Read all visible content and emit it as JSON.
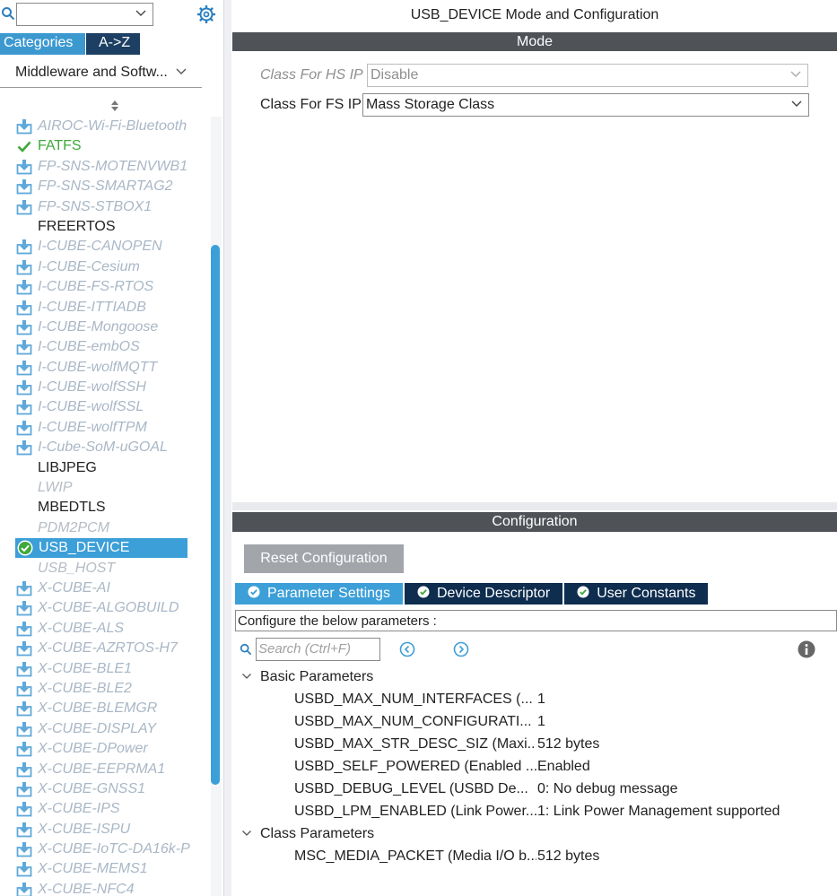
{
  "left_panel": {
    "search_value": "",
    "tabs": {
      "categories": "Categories",
      "az": "A->Z"
    },
    "category_select": "Middleware and Softw...",
    "items": [
      {
        "label": "AIROC-Wi-Fi-Bluetooth",
        "state": "avail"
      },
      {
        "label": "FATFS",
        "state": "ok"
      },
      {
        "label": "FP-SNS-MOTENVWB1",
        "state": "avail"
      },
      {
        "label": "FP-SNS-SMARTAG2",
        "state": "avail"
      },
      {
        "label": "FP-SNS-STBOX1",
        "state": "avail"
      },
      {
        "label": "FREERTOS",
        "state": "plain"
      },
      {
        "label": "I-CUBE-CANOPEN",
        "state": "avail"
      },
      {
        "label": "I-CUBE-Cesium",
        "state": "avail"
      },
      {
        "label": "I-CUBE-FS-RTOS",
        "state": "avail"
      },
      {
        "label": "I-CUBE-ITTIADB",
        "state": "avail"
      },
      {
        "label": "I-CUBE-Mongoose",
        "state": "avail"
      },
      {
        "label": "I-CUBE-embOS",
        "state": "avail"
      },
      {
        "label": "I-CUBE-wolfMQTT",
        "state": "avail"
      },
      {
        "label": "I-CUBE-wolfSSH",
        "state": "avail"
      },
      {
        "label": "I-CUBE-wolfSSL",
        "state": "avail"
      },
      {
        "label": "I-CUBE-wolfTPM",
        "state": "avail"
      },
      {
        "label": "I-Cube-SoM-uGOAL",
        "state": "avail"
      },
      {
        "label": "LIBJPEG",
        "state": "plain"
      },
      {
        "label": "LWIP",
        "state": "dim"
      },
      {
        "label": "MBEDTLS",
        "state": "plain"
      },
      {
        "label": "PDM2PCM",
        "state": "dim"
      },
      {
        "label": "USB_DEVICE",
        "state": "selected"
      },
      {
        "label": "USB_HOST",
        "state": "dim"
      },
      {
        "label": "X-CUBE-AI",
        "state": "avail"
      },
      {
        "label": "X-CUBE-ALGOBUILD",
        "state": "avail"
      },
      {
        "label": "X-CUBE-ALS",
        "state": "avail"
      },
      {
        "label": "X-CUBE-AZRTOS-H7",
        "state": "avail"
      },
      {
        "label": "X-CUBE-BLE1",
        "state": "avail"
      },
      {
        "label": "X-CUBE-BLE2",
        "state": "avail"
      },
      {
        "label": "X-CUBE-BLEMGR",
        "state": "avail"
      },
      {
        "label": "X-CUBE-DISPLAY",
        "state": "avail"
      },
      {
        "label": "X-CUBE-DPower",
        "state": "avail"
      },
      {
        "label": "X-CUBE-EEPRMA1",
        "state": "avail"
      },
      {
        "label": "X-CUBE-GNSS1",
        "state": "avail"
      },
      {
        "label": "X-CUBE-IPS",
        "state": "avail"
      },
      {
        "label": "X-CUBE-ISPU",
        "state": "avail"
      },
      {
        "label": "X-CUBE-IoTC-DA16k-P",
        "state": "avail"
      },
      {
        "label": "X-CUBE-MEMS1",
        "state": "avail"
      },
      {
        "label": "X-CUBE-NFC4",
        "state": "avail"
      }
    ]
  },
  "right_panel": {
    "title": "USB_DEVICE Mode and Configuration",
    "mode_header": "Mode",
    "mode_rows": [
      {
        "label": "Class For HS IP",
        "value": "Disable",
        "disabled": true
      },
      {
        "label": "Class For FS IP",
        "value": "Mass Storage Class",
        "disabled": false
      }
    ],
    "config_header": "Configuration",
    "reset_button": "Reset Configuration",
    "param_tabs": [
      {
        "label": "Parameter Settings",
        "active": true
      },
      {
        "label": "Device Descriptor",
        "active": false
      },
      {
        "label": "User Constants",
        "active": false
      }
    ],
    "configure_text": "Configure the below parameters :",
    "search_placeholder": "Search (Ctrl+F)",
    "groups": [
      {
        "label": "Basic Parameters",
        "params": [
          {
            "name": "USBD_MAX_NUM_INTERFACES (...",
            "value": "1"
          },
          {
            "name": "USBD_MAX_NUM_CONFIGURATI...",
            "value": "1"
          },
          {
            "name": "USBD_MAX_STR_DESC_SIZ (Maxi...",
            "value": "512 bytes"
          },
          {
            "name": "USBD_SELF_POWERED (Enabled ...",
            "value": "Enabled"
          },
          {
            "name": "USBD_DEBUG_LEVEL (USBD De...",
            "value": "0: No debug message"
          },
          {
            "name": "USBD_LPM_ENABLED (Link Power...",
            "value": "1: Link Power Management supported"
          }
        ]
      },
      {
        "label": "Class Parameters",
        "params": [
          {
            "name": "MSC_MEDIA_PACKET (Media I/O b...",
            "value": "512 bytes"
          }
        ]
      }
    ]
  },
  "colors": {
    "accent": "#3c9fd8",
    "dark_tab": "#0e2d4f",
    "section_bar": "#4f5358",
    "available_text": "#a9b7c6",
    "ok_green": "#3fa83c"
  }
}
